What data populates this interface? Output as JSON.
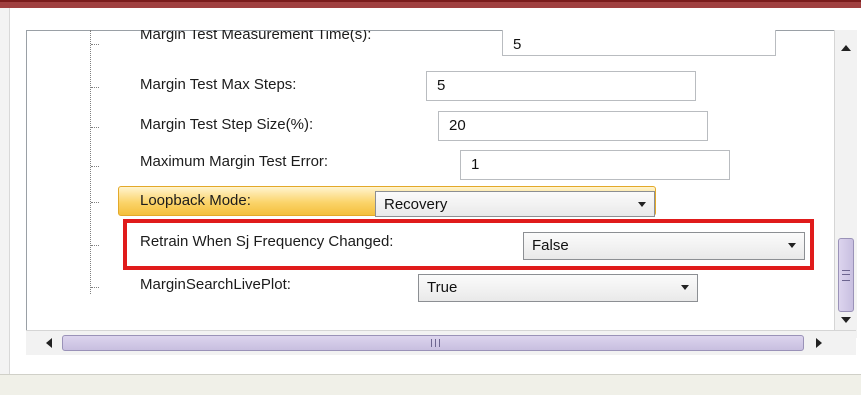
{
  "settings": {
    "rows": [
      {
        "label": "Margin Test Measurement Time(s):",
        "kind": "text",
        "value": "5"
      },
      {
        "label": "Margin Test Max Steps:",
        "kind": "text",
        "value": "5"
      },
      {
        "label": "Margin Test Step Size(%):",
        "kind": "text",
        "value": "20"
      },
      {
        "label": "Maximum Margin Test Error:",
        "kind": "text",
        "value": "1"
      },
      {
        "label": "Loopback Mode:",
        "kind": "select",
        "value": "Recovery",
        "selected": true
      },
      {
        "label": "Retrain When Sj Frequency Changed:",
        "kind": "select",
        "value": "False",
        "highlighted": true
      },
      {
        "label": "MarginSearchLivePlot:",
        "kind": "select",
        "value": "True"
      }
    ]
  },
  "colors": {
    "selection_row": "#f9cc55",
    "highlight_box": "#e01b1b",
    "scroll_thumb": "#d3cbe9",
    "title_bar": "#8a2a2a"
  },
  "icons": {
    "dropdown": "chevron-down-icon",
    "scroll_up": "arrow-up-icon",
    "scroll_down": "arrow-down-icon",
    "scroll_left": "arrow-left-icon",
    "scroll_right": "arrow-right-icon"
  }
}
